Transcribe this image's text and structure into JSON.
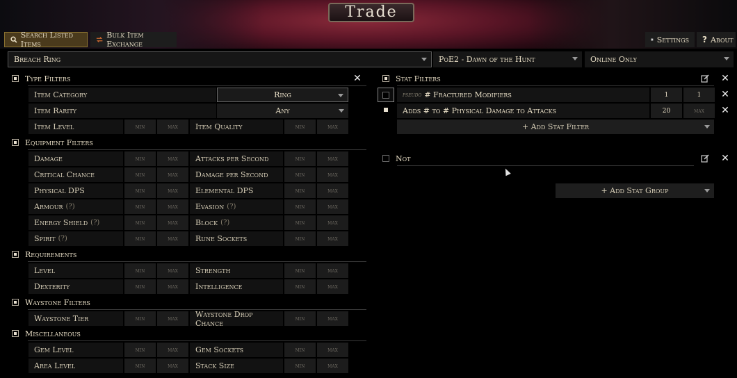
{
  "logo_text": "Trade",
  "tabs": {
    "search": "Search Listed Items",
    "bulk": "Bulk Item Exchange",
    "settings": "Settings",
    "about": "About"
  },
  "search": {
    "value": "Breach Ring",
    "league": "PoE2 - Dawn of the Hunt",
    "status": "Online Only"
  },
  "placeholders": {
    "min": "min",
    "max": "max"
  },
  "type_filters": {
    "title": "Type Filters",
    "category_label": "Item Category",
    "category_value": "Ring",
    "rarity_label": "Item Rarity",
    "rarity_value": "Any",
    "level_label": "Item Level",
    "quality_label": "Item Quality"
  },
  "equipment_filters": {
    "title": "Equipment Filters",
    "rows": [
      {
        "left": "Damage",
        "right": "Attacks per Second"
      },
      {
        "left": "Critical Chance",
        "right": "Damage per Second"
      },
      {
        "left": "Physical DPS",
        "right": "Elemental DPS"
      },
      {
        "left": "Armour",
        "right": "Evasion"
      },
      {
        "left": "Energy Shield",
        "right": "Block"
      },
      {
        "left": "Spirit",
        "right": "Rune Sockets"
      }
    ],
    "help": "(?)"
  },
  "requirements": {
    "title": "Requirements",
    "rows": [
      {
        "left": "Level",
        "right": "Strength"
      },
      {
        "left": "Dexterity",
        "right": "Intelligence"
      }
    ]
  },
  "waystone_filters": {
    "title": "Waystone Filters",
    "rows": [
      {
        "left": "Waystone Tier",
        "right": "Waystone Drop Chance"
      }
    ]
  },
  "miscellaneous": {
    "title": "Miscellaneous",
    "rows": [
      {
        "left": "Gem Level",
        "right": "Gem Sockets"
      },
      {
        "left": "Area Level",
        "right": "Stack Size"
      }
    ]
  },
  "stat_filters": {
    "title": "Stat Filters",
    "rows": [
      {
        "prefix": "pseudo",
        "text": "# Fractured Modifiers",
        "min": "1",
        "max": "1"
      },
      {
        "prefix": "",
        "text": "Adds # to # Physical Damage to Attacks",
        "min": "20",
        "max": "max"
      }
    ],
    "add_label": "+ Add Stat Filter"
  },
  "not_group": {
    "title": "Not"
  },
  "add_group_label": "+ Add Stat Group",
  "colors": {
    "accent_tab": "#4a3a1c",
    "banner": "#5a1526"
  }
}
